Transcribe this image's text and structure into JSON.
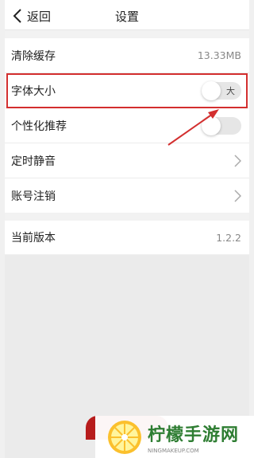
{
  "nav": {
    "back_label": "返回",
    "title": "设置"
  },
  "settings": {
    "cache": {
      "label": "清除缓存",
      "value": "13.33MB"
    },
    "font_size": {
      "label": "字体大小",
      "toggle_text": "大"
    },
    "personalized": {
      "label": "个性化推荐"
    },
    "scheduled_mute": {
      "label": "定时静音"
    },
    "account_cancel": {
      "label": "账号注销"
    },
    "version": {
      "label": "当前版本",
      "value": "1.2.2"
    }
  },
  "watermark": {
    "title": "柠檬手游网",
    "subtitle": "NINGMAKEUP.COM"
  },
  "colors": {
    "highlight": "#d32f2f",
    "brand": "#2e7d32"
  }
}
